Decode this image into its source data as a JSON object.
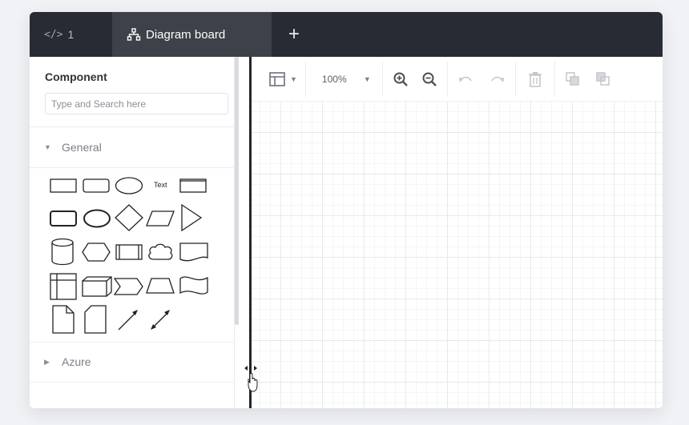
{
  "tabs": [
    {
      "icon": "code-icon",
      "icon_text": "</>",
      "label": "1",
      "active": false
    },
    {
      "icon": "diagram-icon",
      "label": "Diagram board",
      "active": true
    }
  ],
  "add_tab_label": "+",
  "sidebar": {
    "title": "Component",
    "search_placeholder": "Type and Search here",
    "sections": [
      {
        "label": "General",
        "expanded": true
      },
      {
        "label": "Azure",
        "expanded": false
      }
    ],
    "shapes": [
      "rectangle",
      "rounded-rectangle",
      "ellipse",
      "text",
      "heading-box",
      "rounded-box",
      "circle",
      "diamond",
      "parallelogram",
      "triangle",
      "cylinder",
      "hexagon",
      "process",
      "cloud",
      "document",
      "internal-storage",
      "cube",
      "step",
      "trapezoid",
      "tape",
      "note",
      "card",
      "arrow",
      "bidirectional-arrow"
    ],
    "text_shape_label": "Text"
  },
  "toolbar": {
    "zoom": "100%",
    "buttons": [
      "layout-icon",
      "zoom-in-icon",
      "zoom-out-icon",
      "undo-icon",
      "redo-icon",
      "delete-icon",
      "bring-to-front-icon",
      "send-to-back-icon"
    ]
  },
  "colors": {
    "tabbar_bg": "#272b33",
    "active_tab_bg": "#3d4149",
    "splitter": "#23262c",
    "grid": "#e7e9ec"
  }
}
